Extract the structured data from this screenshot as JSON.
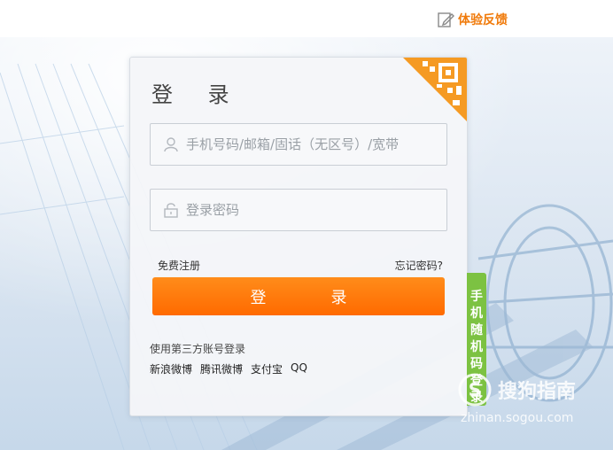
{
  "header": {
    "feedback_label": "体验反馈"
  },
  "login": {
    "title": "登 录",
    "account_placeholder": "手机号码/邮箱/固话（无区号）/宽带",
    "password_placeholder": "登录密码",
    "register_link": "免费注册",
    "forgot_link": "忘记密码?",
    "submit_label": "登 录",
    "third_party_title": "使用第三方账号登录",
    "third_party": [
      "新浪微博",
      "腾讯微博",
      "支付宝",
      "QQ"
    ]
  },
  "side_tab": {
    "chars": [
      "手",
      "机",
      "随",
      "机",
      "码",
      "登",
      "录"
    ]
  },
  "watermark": {
    "main": "搜狗指南",
    "sub": "zhinan.sogou.com"
  },
  "colors": {
    "accent": "#ff6a00",
    "feedback": "#f07a0a",
    "side_tab": "#7cc242",
    "qr": "#f59a23"
  },
  "icons": [
    "edit-icon",
    "user-icon",
    "lock-icon",
    "qrcode-icon",
    "sogou-logo-icon"
  ]
}
